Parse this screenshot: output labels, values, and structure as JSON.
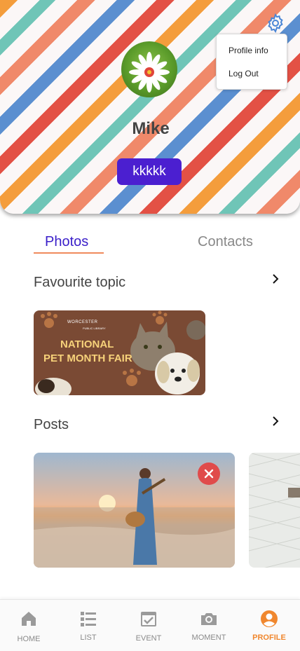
{
  "profile": {
    "name": "Mike",
    "badge": "kkkkk"
  },
  "menu": {
    "items": [
      {
        "label": "Profile info"
      },
      {
        "label": "Log Out"
      }
    ]
  },
  "tabs": [
    {
      "label": "Photos",
      "active": true
    },
    {
      "label": "Contacts",
      "active": false
    }
  ],
  "sections": {
    "favourite_topic": {
      "title": "Favourite topic",
      "card": {
        "org_line1": "WORCESTER",
        "org_line2": "PUBLIC LIBRARY",
        "headline1": "NATIONAL",
        "headline2": "PET MONTH FAIR"
      }
    },
    "posts": {
      "title": "Posts"
    }
  },
  "nav": {
    "items": [
      {
        "label": "HOME",
        "icon": "home-icon",
        "active": false
      },
      {
        "label": "LIST",
        "icon": "list-icon",
        "active": false
      },
      {
        "label": "EVENT",
        "icon": "event-icon",
        "active": false
      },
      {
        "label": "MOMENT",
        "icon": "camera-icon",
        "active": false
      },
      {
        "label": "PROFILE",
        "icon": "profile-icon",
        "active": true
      }
    ]
  },
  "colors": {
    "accent": "#4b1fd0",
    "active_nav": "#f0872e",
    "tab_underline": "#f08a5c",
    "delete": "#e04b4b"
  }
}
